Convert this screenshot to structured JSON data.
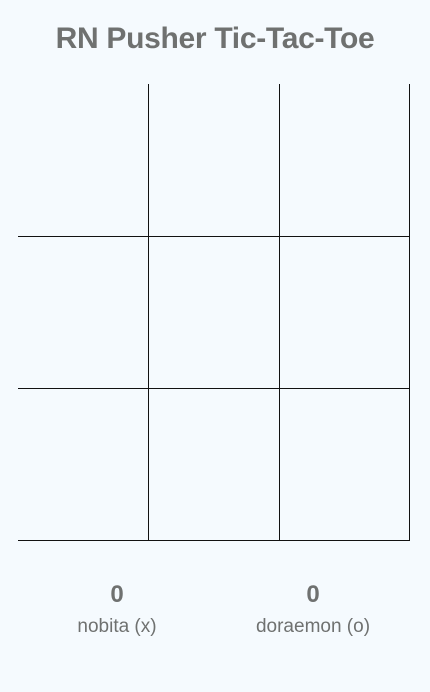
{
  "app": {
    "title": "RN Pusher Tic-Tac-Toe"
  },
  "board": {
    "cells": [
      [
        "",
        "",
        ""
      ],
      [
        "",
        "",
        ""
      ],
      [
        "",
        "",
        ""
      ]
    ]
  },
  "players": [
    {
      "score": "0",
      "name": "nobita (x)"
    },
    {
      "score": "0",
      "name": "doraemon (o)"
    }
  ],
  "colors": {
    "background": "#f5fafe",
    "text": "#6f7170",
    "grid_lines": "#111111"
  }
}
